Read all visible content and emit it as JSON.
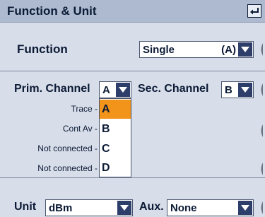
{
  "window": {
    "title": "Function & Unit"
  },
  "function": {
    "label": "Function",
    "value": "Single",
    "suffix": "(A)"
  },
  "prim_channel": {
    "label": "Prim. Channel",
    "value": "A",
    "options": [
      {
        "source": "Trace -",
        "letter": "A",
        "selected": true
      },
      {
        "source": "Cont Av -",
        "letter": "B",
        "selected": false
      },
      {
        "source": "Not connected -",
        "letter": "C",
        "selected": false
      },
      {
        "source": "Not connected -",
        "letter": "D",
        "selected": false
      }
    ]
  },
  "sec_channel": {
    "label": "Sec. Channel",
    "value": "B"
  },
  "unit": {
    "label": "Unit",
    "value": "dBm"
  },
  "aux": {
    "label": "Aux.",
    "value": "None"
  },
  "colors": {
    "background": "#d7dde9",
    "titlebar": "#aebad0",
    "arrow": "#2d3e6a",
    "selection": "#f2941a",
    "text": "#0b1a35"
  },
  "icons": [
    "enter-icon",
    "dropdown-arrow-icon",
    "knob-icon"
  ]
}
